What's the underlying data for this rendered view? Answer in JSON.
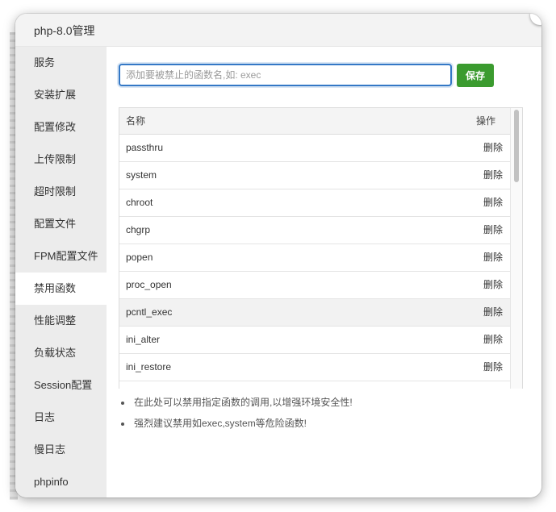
{
  "window": {
    "title": "php-8.0管理"
  },
  "sidebar": {
    "items": [
      {
        "label": "服务"
      },
      {
        "label": "安装扩展"
      },
      {
        "label": "配置修改"
      },
      {
        "label": "上传限制"
      },
      {
        "label": "超时限制"
      },
      {
        "label": "配置文件"
      },
      {
        "label": "FPM配置文件"
      },
      {
        "label": "禁用函数",
        "active": true
      },
      {
        "label": "性能调整"
      },
      {
        "label": "负载状态"
      },
      {
        "label": "Session配置"
      },
      {
        "label": "日志"
      },
      {
        "label": "慢日志"
      },
      {
        "label": "phpinfo"
      }
    ]
  },
  "form": {
    "placeholder": "添加要被禁止的函数名,如: exec",
    "value": "",
    "save_label": "保存"
  },
  "table": {
    "headers": {
      "name": "名称",
      "op": "操作"
    },
    "delete_label": "删除",
    "rows": [
      {
        "name": "passthru"
      },
      {
        "name": "system"
      },
      {
        "name": "chroot"
      },
      {
        "name": "chgrp"
      },
      {
        "name": "popen"
      },
      {
        "name": "proc_open"
      },
      {
        "name": "pcntl_exec",
        "highlighted": true
      },
      {
        "name": "ini_alter"
      },
      {
        "name": "ini_restore"
      },
      {
        "name": ""
      }
    ]
  },
  "notes": [
    "在此处可以禁用指定函数的调用,以增强环境安全性!",
    "强烈建议禁用如exec,system等危险函数!"
  ]
}
